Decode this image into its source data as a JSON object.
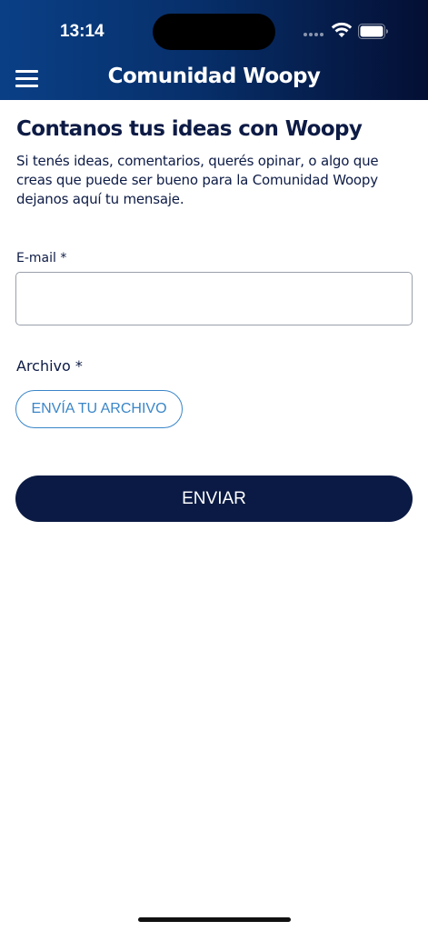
{
  "status_bar": {
    "time": "13:14"
  },
  "header": {
    "title": "Comunidad Woopy",
    "menu_icon": "hamburger-menu-icon",
    "colors": {
      "gradient_start": "#0a3f86",
      "gradient_end": "#040f34"
    }
  },
  "main": {
    "heading": "Contanos tus ideas con Woopy",
    "intro": "Si tenés ideas, comentarios, querés opinar, o algo que creas que puede ser bueno para la Comunidad Woopy dejanos aquí tu mensaje."
  },
  "form": {
    "email_label": "E-mail *",
    "email_value": "",
    "file_label": "Archivo *",
    "file_button": "ENVÍA TU ARCHIVO",
    "submit_button": "ENVIAR"
  },
  "colors": {
    "primary_dark": "#0a1a44",
    "accent_blue": "#3a86c8",
    "text": "#0d1b45"
  }
}
